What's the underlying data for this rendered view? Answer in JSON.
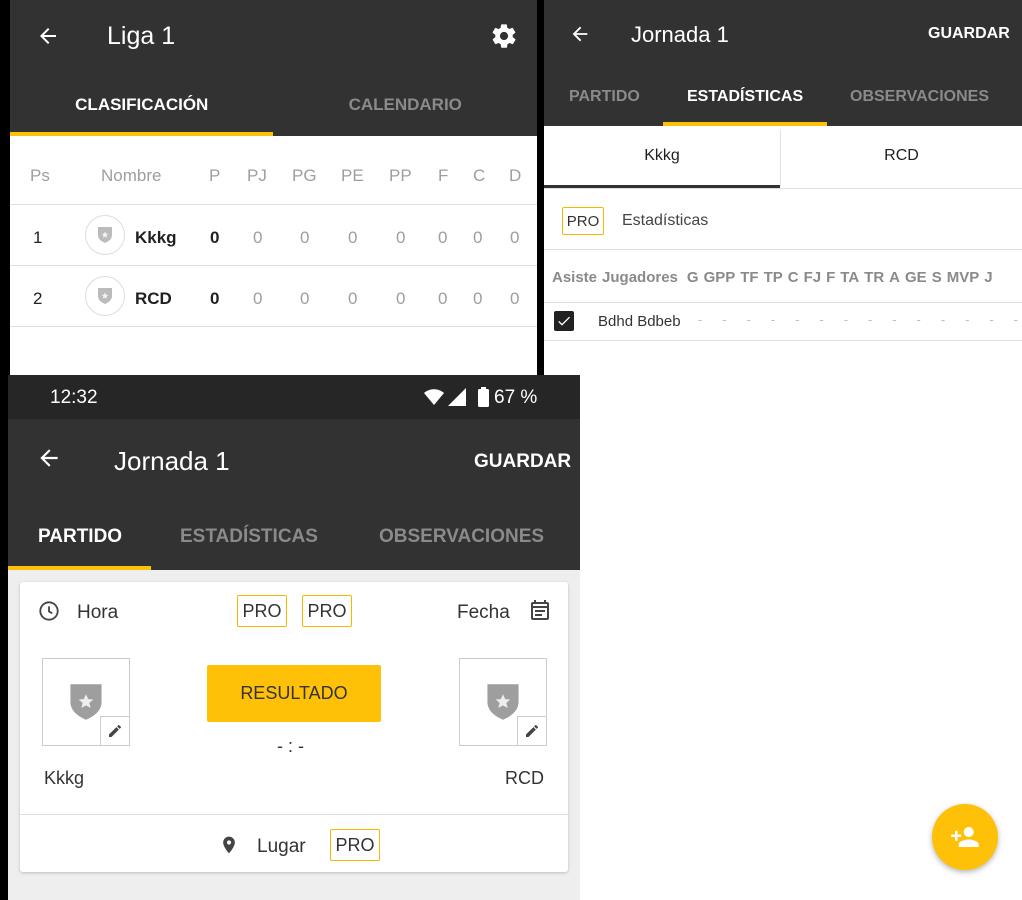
{
  "panel_league": {
    "title": "Liga 1",
    "tabs": [
      "CLASIFICACIÓN",
      "CALENDARIO"
    ],
    "table": {
      "headers": [
        "Ps",
        "Nombre",
        "P",
        "PJ",
        "PG",
        "PE",
        "PP",
        "F",
        "C",
        "D"
      ],
      "rows": [
        {
          "pos": "1",
          "name": "Kkkg",
          "p": "0",
          "pj": "0",
          "pg": "0",
          "pe": "0",
          "pp": "0",
          "f": "0",
          "c": "0",
          "d": "0"
        },
        {
          "pos": "2",
          "name": "RCD",
          "p": "0",
          "pj": "0",
          "pg": "0",
          "pe": "0",
          "pp": "0",
          "f": "0",
          "c": "0",
          "d": "0"
        }
      ]
    }
  },
  "panel_stats": {
    "title": "Jornada 1",
    "save": "GUARDAR",
    "tabs": [
      "PARTIDO",
      "ESTADÍSTICAS",
      "OBSERVACIONES"
    ],
    "teams": [
      "Kkkg",
      "RCD"
    ],
    "pro": "PRO",
    "stats_label": "Estadísticas",
    "columns": [
      "Asiste",
      "Jugadores",
      "G",
      "GPP",
      "TF",
      "TP",
      "C",
      "FJ",
      "F",
      "TA",
      "TR",
      "A",
      "GE",
      "S",
      "MVP",
      "J"
    ],
    "player": "Bdhd Bdbeb",
    "player_values": [
      "-",
      "-",
      "-",
      "-",
      "-",
      "-",
      "-",
      "-",
      "-",
      "-",
      "-",
      "-",
      "-",
      "-"
    ]
  },
  "panel_match": {
    "status_time": "12:32",
    "battery": "67 %",
    "title": "Jornada 1",
    "save": "GUARDAR",
    "tabs": [
      "PARTIDO",
      "ESTADÍSTICAS",
      "OBSERVACIONES"
    ],
    "hora": "Hora",
    "fecha": "Fecha",
    "pro": "PRO",
    "result_button": "RESULTADO",
    "score": "- : -",
    "home": "Kkkg",
    "away": "RCD",
    "lugar": "Lugar"
  },
  "colors": {
    "accent": "#ffc107",
    "appbar": "#323232"
  }
}
